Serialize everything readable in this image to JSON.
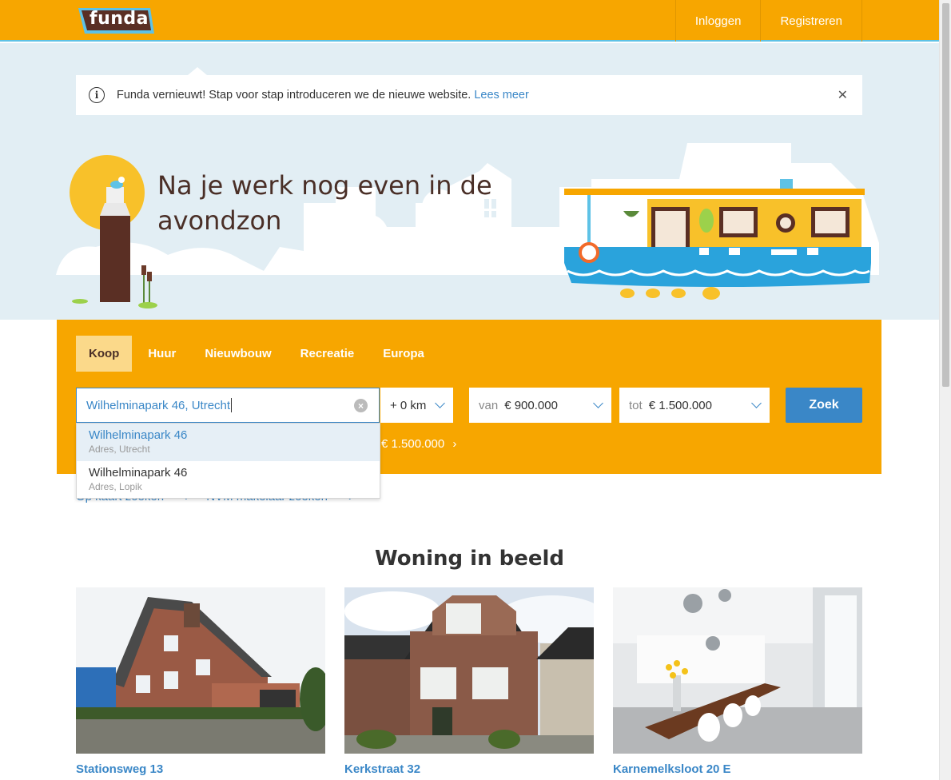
{
  "header": {
    "logo_text": "funda",
    "login_label": "Inloggen",
    "register_label": "Registreren"
  },
  "notice": {
    "text": "Funda vernieuwt! Stap voor stap introduceren we de nieuwe website.",
    "link_label": "Lees meer",
    "close_icon": "close-icon"
  },
  "hero": {
    "title": "Na je werk nog even in de avondzon"
  },
  "search": {
    "tabs": [
      {
        "label": "Koop",
        "active": true
      },
      {
        "label": "Huur",
        "active": false
      },
      {
        "label": "Nieuwbouw",
        "active": false
      },
      {
        "label": "Recreatie",
        "active": false
      },
      {
        "label": "Europa",
        "active": false
      }
    ],
    "query_value": "Wilhelminapark 46, Utrecht",
    "radius_value": "+ 0 km",
    "price_from_prefix": "van",
    "price_from_value": "€ 900.000",
    "price_to_prefix": "tot",
    "price_to_value": "€ 1.500.000",
    "submit_label": "Zoek",
    "recent_search_fragment": "€ 1.500.000"
  },
  "suggestions": [
    {
      "title": "Wilhelminapark 46",
      "subtitle": "Adres, Utrecht"
    },
    {
      "title": "Wilhelminapark 46",
      "subtitle": "Adres, Lopik"
    }
  ],
  "sub_links": {
    "map_search": "Op kaart zoeken",
    "agent_search": "NVM makelaar zoeken"
  },
  "featured": {
    "title": "Woning in beeld",
    "cards": [
      {
        "title": "Stationsweg 13"
      },
      {
        "title": "Kerkstraat 32"
      },
      {
        "title": "Karnemelksloot 20 E"
      }
    ]
  },
  "colors": {
    "brand_orange": "#f7a600",
    "link_blue": "#3a87c7",
    "hero_bg": "#e2eef4"
  }
}
